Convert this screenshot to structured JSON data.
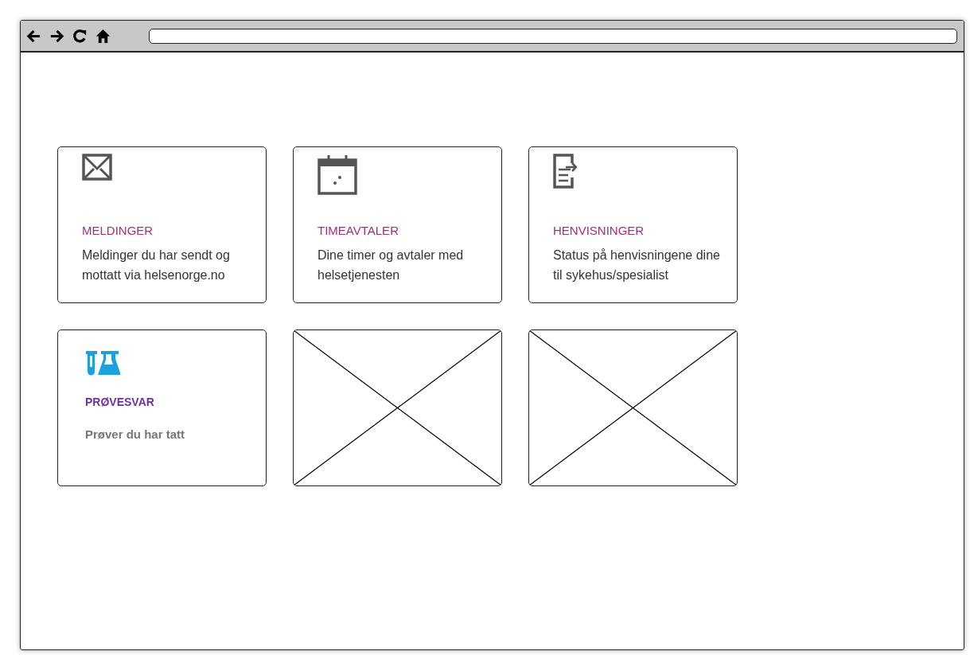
{
  "cards": [
    {
      "kind": "tile",
      "title": "MELDINGER",
      "description": "Meldinger du har sendt og mottatt via helsenorge.no"
    },
    {
      "kind": "tile",
      "title": "TIMEAVTALER",
      "description": "Dine timer og avtaler med helsetjenesten"
    },
    {
      "kind": "tile",
      "title": "HENVISNINGER",
      "description": "Status på henvisningene dine til sykehus/spesialist"
    },
    {
      "kind": "tile-alt",
      "title": "PRØVESVAR",
      "description": "Prøver du har tatt"
    },
    {
      "kind": "placeholder"
    },
    {
      "kind": "placeholder"
    }
  ]
}
